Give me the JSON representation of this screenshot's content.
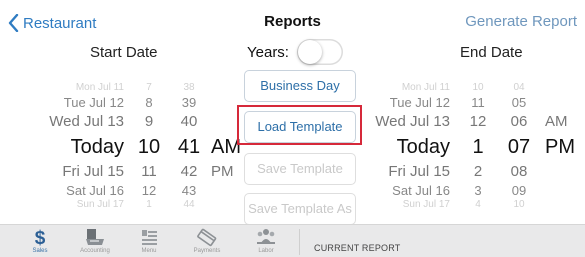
{
  "header": {
    "back_label": "Restaurant",
    "title": "Reports",
    "action_label": "Generate Report"
  },
  "labels": {
    "start_date": "Start Date",
    "end_date": "End Date",
    "years": "Years:"
  },
  "toggle": {
    "years_on": false
  },
  "start_picker": {
    "dates": [
      "Mon Jul 11",
      "Tue Jul 12",
      "Wed Jul 13",
      "Today",
      "Fri Jul 15",
      "Sat Jul 16",
      "Sun Jul 17"
    ],
    "hours": [
      "7",
      "8",
      "9",
      "10",
      "11",
      "12",
      "1"
    ],
    "minutes": [
      "38",
      "39",
      "40",
      "41",
      "42",
      "43",
      "44"
    ],
    "ampm": [
      "",
      "",
      "",
      "AM",
      "PM",
      "",
      ""
    ]
  },
  "end_picker": {
    "dates": [
      "Mon Jul 11",
      "Tue Jul 12",
      "Wed Jul 13",
      "Today",
      "Fri Jul 15",
      "Sat Jul 16",
      "Sun Jul 17"
    ],
    "hours": [
      "10",
      "11",
      "12",
      "1",
      "2",
      "3",
      "4"
    ],
    "minutes": [
      "04",
      "05",
      "06",
      "07",
      "08",
      "09",
      "10"
    ],
    "ampm": [
      "",
      "",
      "AM",
      "PM",
      "",
      "",
      ""
    ]
  },
  "buttons": {
    "business_day": "Business Day",
    "load_template": "Load Template",
    "save_template": "Save Template",
    "save_template_as": "Save Template As"
  },
  "tabbar": {
    "tabs": [
      {
        "label": "Sales",
        "icon": "dollar-icon",
        "active": true
      },
      {
        "label": "Accounting",
        "icon": "printer-icon",
        "active": false
      },
      {
        "label": "Menu",
        "icon": "menu-icon",
        "active": false
      },
      {
        "label": "Payments",
        "icon": "card-icon",
        "active": false
      },
      {
        "label": "Labor",
        "icon": "people-icon",
        "active": false
      }
    ],
    "current_report_label": "CURRENT REPORT"
  },
  "colors": {
    "accent": "#2f7cc2",
    "highlight": "#d6293a",
    "tab_bar": "#e9e9ea"
  }
}
